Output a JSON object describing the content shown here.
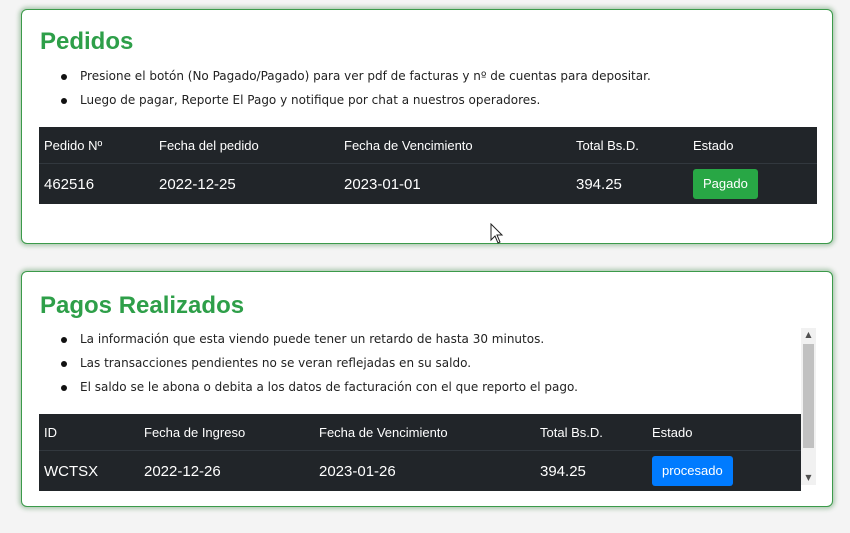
{
  "orders": {
    "title": "Pedidos",
    "notes": [
      "Presione el botón (No Pagado/Pagado) para ver pdf de facturas y nº de cuentas para depositar.",
      "Luego de pagar, Reporte El Pago y notifique por chat a nuestros operadores."
    ],
    "headers": [
      "Pedido Nº",
      "Fecha del pedido",
      "Fecha de Vencimiento",
      "Total Bs.D.",
      "Estado"
    ],
    "rows": [
      {
        "id": "462516",
        "date": "2022-12-25",
        "due": "2023-01-01",
        "total": "394.25",
        "status": "Pagado"
      }
    ]
  },
  "payments": {
    "title": "Pagos Realizados",
    "notes": [
      "La información que esta viendo puede tener un retardo de hasta 30 minutos.",
      "Las transacciones pendientes no se veran reflejadas en su saldo.",
      "El saldo se le abona o debita a los datos de facturación con el que reporto el pago."
    ],
    "headers": [
      "ID",
      "Fecha de Ingreso",
      "Fecha de Vencimiento",
      "Total Bs.D.",
      "Estado"
    ],
    "rows": [
      {
        "id": "WCTSX",
        "date": "2022-12-26",
        "due": "2023-01-26",
        "total": "394.25",
        "status": "procesado"
      }
    ]
  },
  "colors": {
    "title_green": "#2e9f49",
    "table_dark": "#212529",
    "badge_success": "#28a745",
    "badge_primary": "#007bff"
  },
  "icons": [
    "scroll-up-arrow-icon",
    "scroll-down-arrow-icon",
    "mouse-cursor-icon"
  ]
}
